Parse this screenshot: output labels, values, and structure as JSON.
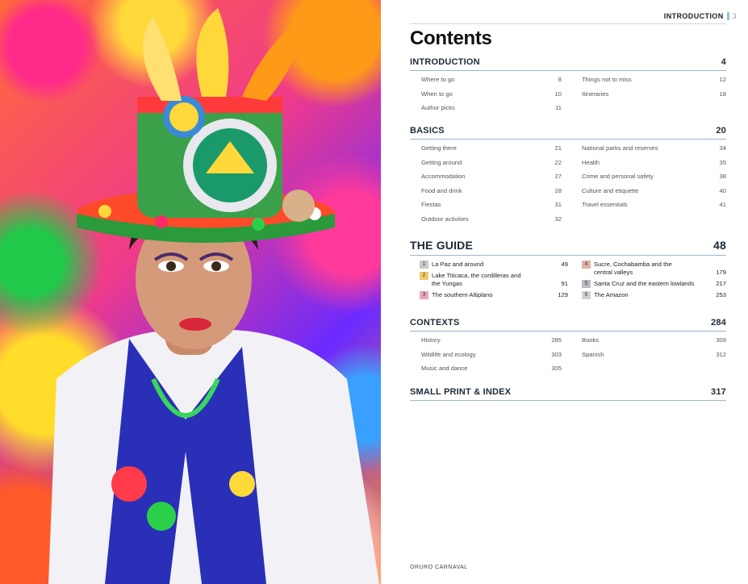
{
  "photo": {
    "caption": "ORURO CARNAVAL"
  },
  "running_head": {
    "label": "INTRODUCTION",
    "page": "3"
  },
  "title": "Contents",
  "colors": {
    "rule": "#9cb5c6",
    "chapter1": "#c9c9c9",
    "chapter2": "#f4c96a",
    "chapter3": "#e8a9b4",
    "chapter4": "#e0b3a6",
    "chapter5": "#b9bdc2",
    "chapter6": "#d6d0cc"
  },
  "introduction": {
    "heading": "INTRODUCTION",
    "page": "4",
    "left": [
      {
        "label": "Where to go",
        "page": "8"
      },
      {
        "label": "When to go",
        "page": "10"
      },
      {
        "label": "Author picks",
        "page": "11"
      }
    ],
    "right": [
      {
        "label": "Things not to miss",
        "page": "12"
      },
      {
        "label": "Itineraries",
        "page": "18"
      }
    ]
  },
  "basics": {
    "heading": "BASICS",
    "page": "20",
    "left": [
      {
        "label": "Getting there",
        "page": "21"
      },
      {
        "label": "Getting around",
        "page": "22"
      },
      {
        "label": "Accommodation",
        "page": "27"
      },
      {
        "label": "Food and drink",
        "page": "28"
      },
      {
        "label": "Fiestas",
        "page": "31"
      },
      {
        "label": "Outdoor activities",
        "page": "32"
      }
    ],
    "right": [
      {
        "label": "National parks and reserves",
        "page": "34"
      },
      {
        "label": "Health",
        "page": "35"
      },
      {
        "label": "Crime and personal safety",
        "page": "38"
      },
      {
        "label": "Culture and etiquette",
        "page": "40"
      },
      {
        "label": "Travel essentials",
        "page": "41"
      }
    ]
  },
  "guide": {
    "heading": "THE GUIDE",
    "page": "48",
    "left": [
      {
        "num": "1",
        "label": "La Paz and around",
        "page": "49"
      },
      {
        "num": "2",
        "label": "Lake Titicaca, the cordilleras and the Yungas",
        "page": "91"
      },
      {
        "num": "3",
        "label": "The southern Altiplano",
        "page": "129"
      }
    ],
    "right": [
      {
        "num": "4",
        "label": "Sucre, Cochabamba and the central valleys",
        "page": "179"
      },
      {
        "num": "5",
        "label": "Santa Cruz and the eastern lowlands",
        "page": "217"
      },
      {
        "num": "6",
        "label": "The Amazon",
        "page": "253"
      }
    ]
  },
  "contexts": {
    "heading": "CONTEXTS",
    "page": "284",
    "left": [
      {
        "label": "History",
        "page": "285"
      },
      {
        "label": "Wildlife and ecology",
        "page": "303"
      },
      {
        "label": "Music and dance",
        "page": "305"
      }
    ],
    "right": [
      {
        "label": "Books",
        "page": "309"
      },
      {
        "label": "Spanish",
        "page": "312"
      }
    ]
  },
  "small_print": {
    "heading": "SMALL PRINT & INDEX",
    "page": "317"
  }
}
